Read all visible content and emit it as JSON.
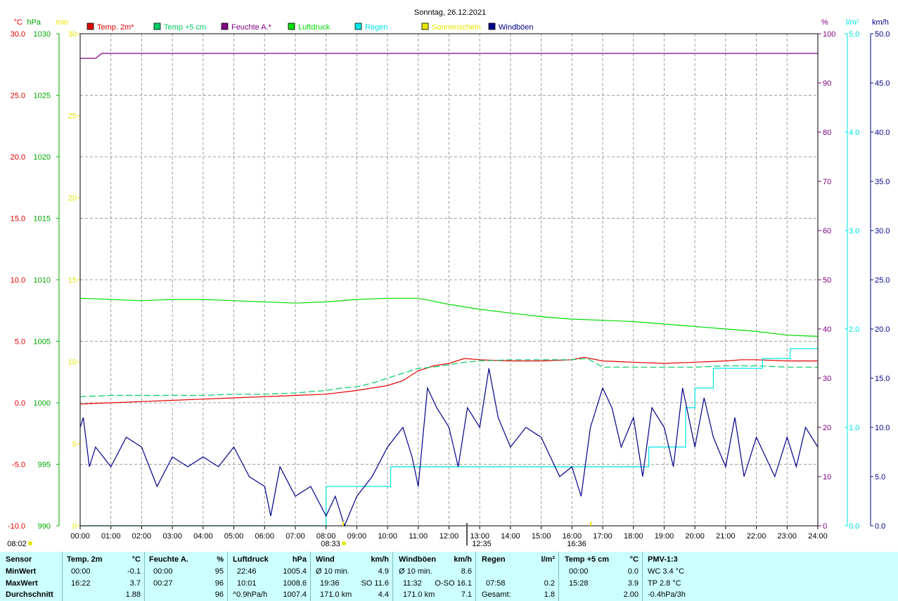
{
  "title": "Sonntag, 26.12.2021",
  "colors": {
    "temp2m": "#e00000",
    "temp5cm": "#00cc66",
    "humidity": "#800080",
    "pressure": "#00dd00",
    "rain": "#00e5e5",
    "sunshine": "#e6e600",
    "gusts": "#00008b",
    "grid": "#9c9c9c",
    "panel": "#ccffff"
  },
  "legend": [
    {
      "label": "Temp. 2m*",
      "color": "#e00000"
    },
    {
      "label": "Temp +5 cm",
      "color": "#00cc66"
    },
    {
      "label": "Feuchte A.*",
      "color": "#800080"
    },
    {
      "label": "Luftdruck",
      "color": "#00dd00"
    },
    {
      "label": "Regen",
      "color": "#00e5e5"
    },
    {
      "label": "Sonnenschein",
      "color": "#e6e600"
    },
    {
      "label": "Windböen",
      "color": "#00008b"
    }
  ],
  "chart_data": {
    "type": "line",
    "title": "Sonntag, 26.12.2021",
    "x_ticks": [
      "00:00",
      "01:00",
      "02:00",
      "03:00",
      "04:00",
      "05:00",
      "06:00",
      "07:00",
      "08:00",
      "09:00",
      "10:00",
      "11:00",
      "12:00",
      "13:00",
      "14:00",
      "15:00",
      "16:00",
      "17:00",
      "18:00",
      "19:00",
      "20:00",
      "21:00",
      "22:00",
      "23:00",
      "24:00"
    ],
    "xlim": [
      0,
      24
    ],
    "axes": {
      "temp": {
        "unit": "°C",
        "ylim": [
          -10,
          30
        ],
        "ticks": [
          "-10.0",
          "-5.0",
          "0.0",
          "5.0",
          "10.0",
          "15.0",
          "20.0",
          "25.0",
          "30.0"
        ],
        "color": "#e00000"
      },
      "pressure": {
        "unit": "hPa",
        "ylim": [
          990,
          1030
        ],
        "ticks": [
          "990",
          "995",
          "1000",
          "1005",
          "1010",
          "1015",
          "1020",
          "1025",
          "1030"
        ],
        "color": "#00aa00"
      },
      "sunshine": {
        "unit": "min",
        "ylim": [
          0,
          30
        ],
        "ticks": [
          "0",
          "5",
          "10",
          "15",
          "20",
          "25",
          "30"
        ],
        "color": "#e6e600"
      },
      "humidity": {
        "unit": "%",
        "ylim": [
          0,
          100
        ],
        "ticks": [
          "0",
          "10",
          "20",
          "30",
          "40",
          "50",
          "60",
          "70",
          "80",
          "90",
          "100"
        ],
        "color": "#800080"
      },
      "rain": {
        "unit": "l/m²",
        "ylim": [
          0,
          5
        ],
        "ticks": [
          "0.0",
          "1.0",
          "2.0",
          "3.0",
          "4.0",
          "5.0"
        ],
        "color": "#00e5e5"
      },
      "wind": {
        "unit": "km/h",
        "ylim": [
          0,
          50
        ],
        "ticks": [
          "0.0",
          "5.0",
          "10.0",
          "15.0",
          "20.0",
          "25.0",
          "30.0",
          "35.0",
          "40.0",
          "45.0",
          "50.0"
        ],
        "color": "#00008b"
      }
    },
    "series": [
      {
        "name": "Temp. 2m*",
        "axis": "temp",
        "x": [
          0,
          1,
          2,
          3,
          4,
          5,
          6,
          7,
          8,
          9,
          10,
          10.5,
          11,
          11.5,
          12,
          12.5,
          13,
          14,
          15,
          16,
          16.4,
          17,
          18,
          19,
          20,
          21,
          21.5,
          22,
          23,
          24
        ],
        "y": [
          -0.1,
          0.0,
          0.1,
          0.2,
          0.3,
          0.4,
          0.5,
          0.6,
          0.7,
          1.0,
          1.4,
          1.8,
          2.6,
          3.0,
          3.2,
          3.6,
          3.5,
          3.4,
          3.4,
          3.5,
          3.7,
          3.4,
          3.3,
          3.2,
          3.3,
          3.4,
          3.5,
          3.5,
          3.4,
          3.4
        ]
      },
      {
        "name": "Temp +5 cm",
        "axis": "temp",
        "x": [
          0,
          1,
          2,
          3,
          4,
          5,
          6,
          7,
          8,
          8.5,
          9,
          9.5,
          10,
          10.5,
          11,
          11.5,
          12,
          12.5,
          13,
          14,
          15,
          16,
          16.5,
          17,
          18,
          19,
          20,
          21,
          22,
          23,
          24
        ],
        "y": [
          0.5,
          0.6,
          0.6,
          0.6,
          0.6,
          0.7,
          0.7,
          0.8,
          1.0,
          1.2,
          1.3,
          1.6,
          2.0,
          2.4,
          2.8,
          2.9,
          3.1,
          3.3,
          3.4,
          3.5,
          3.5,
          3.5,
          3.6,
          2.9,
          2.9,
          2.9,
          2.9,
          3.0,
          3.0,
          2.9,
          2.9
        ]
      },
      {
        "name": "Feuchte A.*",
        "axis": "humidity",
        "x": [
          0,
          0.5,
          0.7,
          1,
          2,
          24
        ],
        "y": [
          95,
          95,
          96,
          96,
          96,
          96
        ]
      },
      {
        "name": "Luftdruck",
        "axis": "pressure",
        "x": [
          0,
          1,
          2,
          3,
          4,
          5,
          6,
          7,
          8,
          9,
          10,
          11,
          12,
          13,
          14,
          15,
          16,
          17,
          18,
          19,
          20,
          21,
          22,
          23,
          24
        ],
        "y": [
          1008.5,
          1008.4,
          1008.3,
          1008.4,
          1008.4,
          1008.3,
          1008.2,
          1008.1,
          1008.2,
          1008.4,
          1008.5,
          1008.5,
          1008.0,
          1007.6,
          1007.3,
          1007.0,
          1006.8,
          1006.7,
          1006.6,
          1006.4,
          1006.2,
          1006.0,
          1005.8,
          1005.5,
          1005.4
        ]
      },
      {
        "name": "Regen",
        "axis": "rain",
        "x": [
          0,
          7.98,
          8.0,
          10.0,
          10.1,
          18.4,
          18.5,
          19.6,
          19.7,
          20.0,
          20.6,
          21.0,
          22.0,
          22.2,
          23.0,
          23.1,
          24
        ],
        "y": [
          0,
          0,
          0.4,
          0.4,
          0.6,
          0.6,
          0.8,
          0.8,
          1.2,
          1.4,
          1.6,
          1.6,
          1.6,
          1.7,
          1.7,
          1.8,
          1.8
        ]
      },
      {
        "name": "Windböen",
        "axis": "wind",
        "x": [
          0,
          0.1,
          0.3,
          0.5,
          1,
          1.5,
          2,
          2.5,
          3,
          3.5,
          4,
          4.5,
          5,
          5.5,
          6,
          6.2,
          6.5,
          7,
          7.5,
          8,
          8.3,
          8.6,
          9,
          9.5,
          10,
          10.5,
          10.8,
          11,
          11.3,
          11.6,
          12,
          12.3,
          12.6,
          13,
          13.3,
          13.6,
          14,
          14.5,
          15,
          15.3,
          15.6,
          16,
          16.3,
          16.6,
          17,
          17.3,
          17.6,
          18,
          18.3,
          18.6,
          19,
          19.3,
          19.6,
          20,
          20.3,
          20.6,
          21,
          21.3,
          21.6,
          22,
          22.3,
          22.6,
          23,
          23.3,
          23.6,
          24
        ],
        "y": [
          10,
          11,
          6,
          8,
          6,
          9,
          8,
          4,
          7,
          6,
          7,
          6,
          8,
          5,
          4,
          1,
          6,
          3,
          4,
          1,
          3,
          0,
          3,
          5,
          8,
          10,
          7,
          4,
          14,
          12,
          10,
          6,
          12,
          10,
          16,
          11,
          8,
          10,
          9,
          7,
          5,
          6,
          3,
          10,
          14,
          12,
          8,
          11,
          5,
          12,
          10,
          6,
          14,
          8,
          13,
          9,
          6,
          11,
          5,
          9,
          7,
          5,
          9,
          6,
          10,
          8
        ]
      }
    ],
    "time_markers": [
      {
        "label": "08:02",
        "x_label": "08:02"
      },
      {
        "label": "08:33",
        "x_label": "08:33"
      },
      {
        "label": "12:35",
        "x_label": "12:35"
      },
      {
        "label": "16:36",
        "x_label": "16:36"
      }
    ]
  },
  "summary": {
    "sensor": {
      "header": "Sensor",
      "min": "MinWert",
      "max": "MaxWert",
      "avg": "Durchschnitt"
    },
    "temp2m": {
      "header": "Temp. 2m",
      "unit": "°C",
      "min_t": "00:00",
      "min_v": "-0.1",
      "max_t": "16:22",
      "max_v": "3.7",
      "avg_v": "1.88"
    },
    "humidity": {
      "header": "Feuchte A.",
      "unit": "%",
      "min_t": "00:00",
      "min_v": "95",
      "max_t": "00:27",
      "max_v": "96",
      "avg_v": "96"
    },
    "pressure": {
      "header": "Luftdruck",
      "unit": "hPa",
      "min_t": "22:46",
      "min_v": "1005.4",
      "max_t": "10:01",
      "max_v": "1008.6",
      "avg_t": "^0.9hPa/h",
      "avg_v": "1007.4"
    },
    "wind": {
      "header": "Wind",
      "unit": "km/h",
      "min_t": "Ø 10 min.",
      "min_v": "4.9",
      "max_t": "19:36",
      "max_v": "SO 11.6",
      "avg_t": "171.0 km",
      "avg_v": "4.4"
    },
    "gusts": {
      "header": "Windböen",
      "unit": "km/h",
      "min_t": "Ø 10 min.",
      "min_v": "8.6",
      "max_t": "11:32",
      "max_v": "O-SO 16.1",
      "avg_t": "171.0 km",
      "avg_v": "7.1"
    },
    "rain": {
      "header": "Regen",
      "unit": "l/m²",
      "max_t": "07:58",
      "max_v": "0.2",
      "avg_t": "Gesamt:",
      "avg_v": "1.8"
    },
    "temp5cm": {
      "header": "Temp +5 cm",
      "unit": "°C",
      "min_t": "00:00",
      "min_v": "0.0",
      "max_t": "15:28",
      "max_v": "3.9",
      "avg_v": "2.00"
    },
    "pmv": {
      "header": "PMV-1:3",
      "l1": "WC 3.4 °C",
      "l2": "TP 2.8 °C",
      "l3": "-0.4hPa/3h"
    }
  }
}
